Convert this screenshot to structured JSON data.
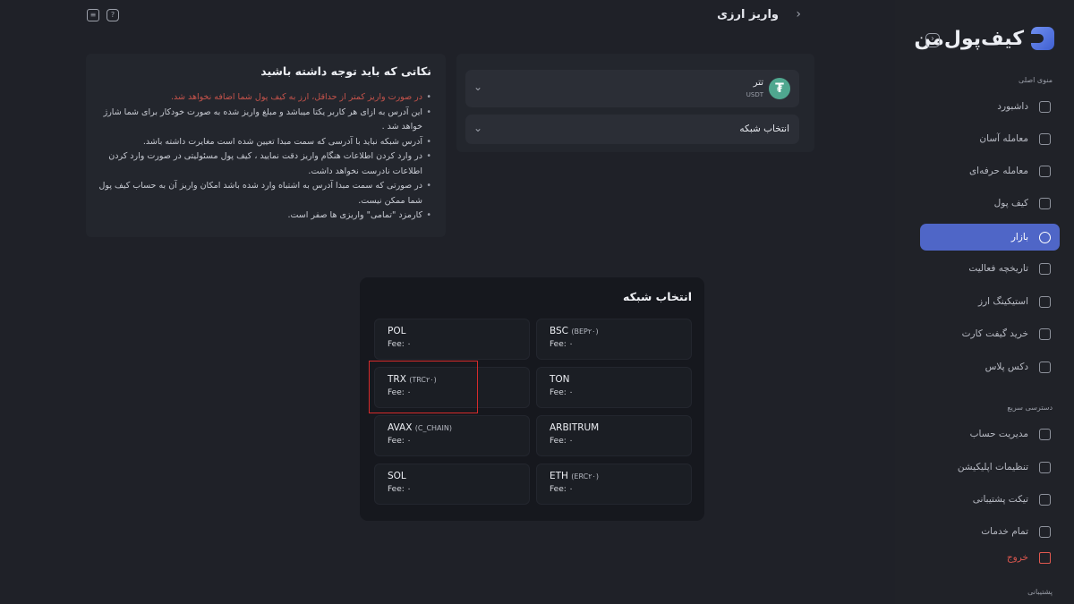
{
  "header": {
    "title": "واریز ارزی",
    "back_icon": "chevron-right-icon",
    "icons": [
      "receipt-icon",
      "help-icon"
    ],
    "help_glyph": "?"
  },
  "sidebar": {
    "brand": "کیف‌پول‌من",
    "section_main": "منوی اصلی",
    "section_quick": "دسترسی سریع",
    "section_support": "پشتیبانی",
    "main_items": [
      {
        "label": "داشبورد",
        "icon": "dashboard-icon"
      },
      {
        "label": "معامله آسان",
        "icon": "easy-trade-icon"
      },
      {
        "label": "معامله حرفه‌ای",
        "icon": "pro-trade-icon"
      },
      {
        "label": "کیف پول",
        "icon": "wallet-icon"
      },
      {
        "label": "بازار",
        "icon": "market-icon",
        "active": true
      },
      {
        "label": "تاریخچه فعالیت",
        "icon": "history-icon"
      },
      {
        "label": "استیکینگ ارز",
        "icon": "staking-icon"
      },
      {
        "label": "خرید گیفت کارت",
        "icon": "gift-card-icon"
      },
      {
        "label": "دکس پلاس",
        "icon": "dex-icon"
      }
    ],
    "quick_items": [
      {
        "label": "مدیریت حساب",
        "icon": "account-icon"
      },
      {
        "label": "تنظیمات اپلیکیشن",
        "icon": "settings-icon"
      },
      {
        "label": "تیکت پشتیبانی",
        "icon": "ticket-icon"
      },
      {
        "label": "تمام خدمات",
        "icon": "services-icon"
      },
      {
        "label": "خروج",
        "icon": "logout-icon"
      }
    ],
    "active_color": "#4f66c7"
  },
  "tips": {
    "title": "نکاتی که باید توجه داشته باشید",
    "items": [
      {
        "text": "در صورت واریز کمتر از حداقل، ارز به کیف پول شما اضافه نخواهد شد.",
        "warn": true
      },
      {
        "text": "این آدرس به ازای هر کاربر یکتا میباشد و مبلغ واریز شده به صورت خودکار برای شما شارژ خواهد شد ."
      },
      {
        "text": "آدرس شبکه نباید با آدرسی که سمت مبدا تعیین شده است مغایرت داشته باشد."
      },
      {
        "text": "در وارد کردن اطلاعات هنگام واریز دقت نمایید ، کیف پول مسئولیتی در صورت وارد کردن اطلاعات نادرست نخواهد داشت."
      },
      {
        "text": "در صورتی که سمت مبدا آدرس به اشتباه وارد شده باشد امکان واریز آن به حساب کیف پول شما ممکن نیست."
      },
      {
        "text": "کارمزد \"تمامی\" واریزی ها صفر است."
      }
    ]
  },
  "deposit": {
    "coin_name": "تتر",
    "coin_symbol": "USDT",
    "coin_glyph": "₮",
    "network_label": "انتخاب شبکه"
  },
  "modal": {
    "title": "انتخاب شبکه",
    "networks": [
      {
        "name": "POL",
        "standard": "",
        "fee": "Fee: ۰"
      },
      {
        "name": "BSC",
        "standard": "(BEP۲۰)",
        "fee": "Fee: ۰"
      },
      {
        "name": "TRX",
        "standard": "(TRC۲۰)",
        "fee": "Fee: ۰"
      },
      {
        "name": "TON",
        "standard": "",
        "fee": "Fee: ۰"
      },
      {
        "name": "AVAX",
        "standard": "(C_CHAIN)",
        "fee": "Fee: ۰"
      },
      {
        "name": "ARBITRUM",
        "standard": "",
        "fee": "Fee: ۰"
      },
      {
        "name": "SOL",
        "standard": "",
        "fee": "Fee: ۰"
      },
      {
        "name": "ETH",
        "standard": "(ERC۲۰)",
        "fee": "Fee: ۰"
      }
    ]
  }
}
